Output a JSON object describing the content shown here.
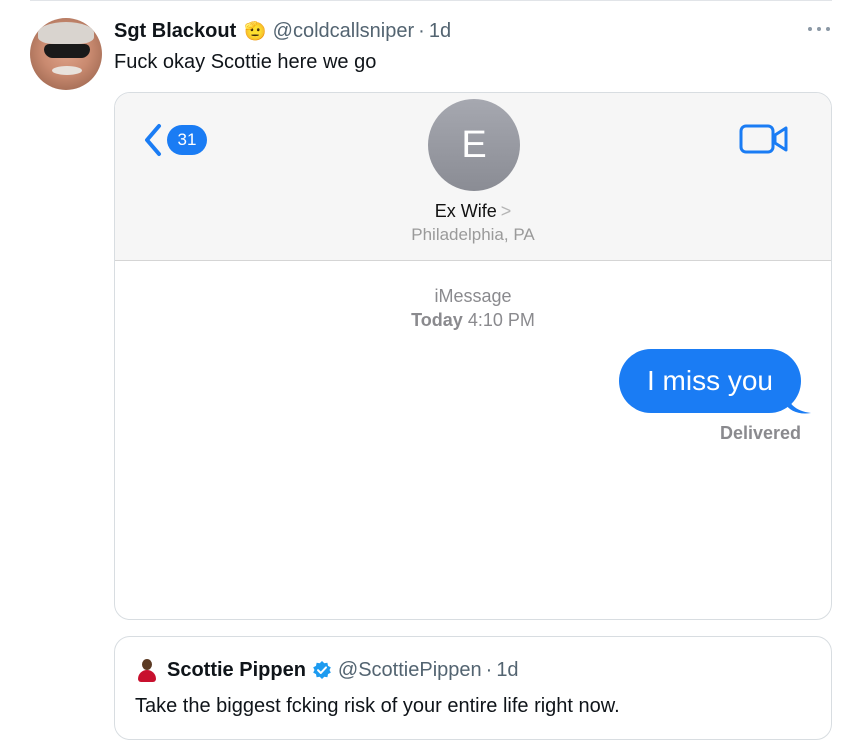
{
  "tweet": {
    "author_name": "Sgt Blackout",
    "author_emoji": "🫡",
    "handle": "@coldcallsniper",
    "separator": "·",
    "time": "1d",
    "text": "Fuck okay Scottie here we go"
  },
  "imessage": {
    "back_count": "31",
    "contact_initial": "E",
    "contact_name": "Ex Wife",
    "contact_chevron": ">",
    "contact_location": "Philadelphia, PA",
    "service": "iMessage",
    "day": "Today",
    "time": "4:10 PM",
    "message": "I miss you",
    "status": "Delivered",
    "accent_color": "#1a7cf4"
  },
  "quote": {
    "author_name": "Scottie Pippen",
    "handle": "@ScottiePippen",
    "separator": "·",
    "time": "1d",
    "text": "Take the biggest fcking risk of your entire life right now.",
    "verified_color": "#1d9bf0"
  },
  "icons": [
    "more-icon",
    "back-chevron-icon",
    "video-camera-icon",
    "verified-badge-icon"
  ]
}
